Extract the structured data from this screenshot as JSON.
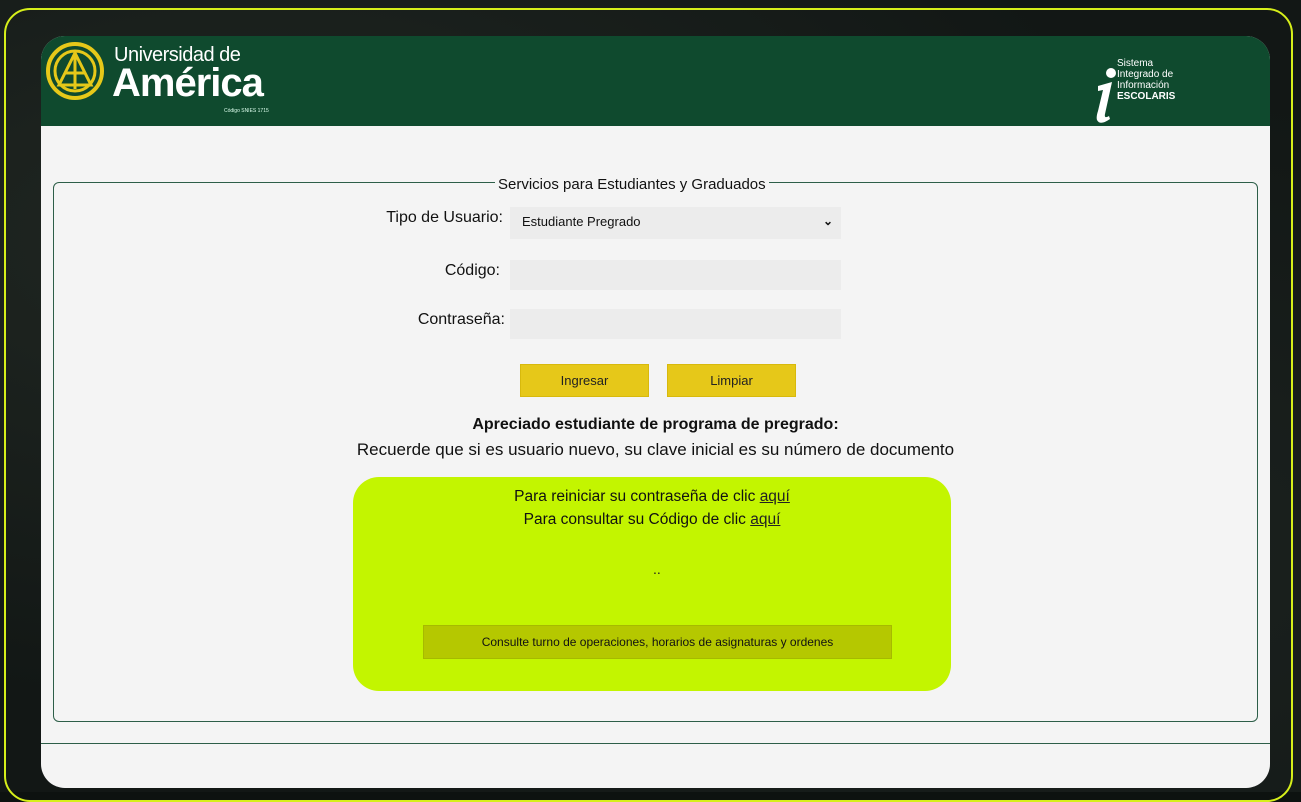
{
  "header": {
    "logo_line1": "Universidad de",
    "logo_line2": "América",
    "logo_small": "Código SNIES 1715",
    "system_line1": "Sistema",
    "system_line2": "Integrado de",
    "system_line3": "Información",
    "system_line4": "ESCOLARIS"
  },
  "form": {
    "legend": "Servicios para Estudiantes y Graduados",
    "user_type_label": "Tipo de Usuario:",
    "user_type_value": "Estudiante Pregrado",
    "code_label": "Código:",
    "password_label": "Contraseña:",
    "login_button": "Ingresar",
    "clear_button": "Limpiar"
  },
  "notice": {
    "title": "Apreciado estudiante de programa de pregrado:",
    "text": "Recuerde que si es usuario nuevo, su clave inicial es su número de documento"
  },
  "links_box": {
    "reset_prefix": "Para reiniciar su contraseña de clic",
    "reset_link": "aquí",
    "code_prefix": "Para consultar su Código de clic",
    "code_link": "aquí",
    "dots": "..",
    "consult_button": "Consulte turno de operaciones, horarios de asignaturas y ordenes"
  },
  "colors": {
    "header_green": "#0f4a2e",
    "button_yellow": "#e6c819",
    "box_lime": "#c3f500",
    "frame_lime": "#d6ef1a"
  }
}
